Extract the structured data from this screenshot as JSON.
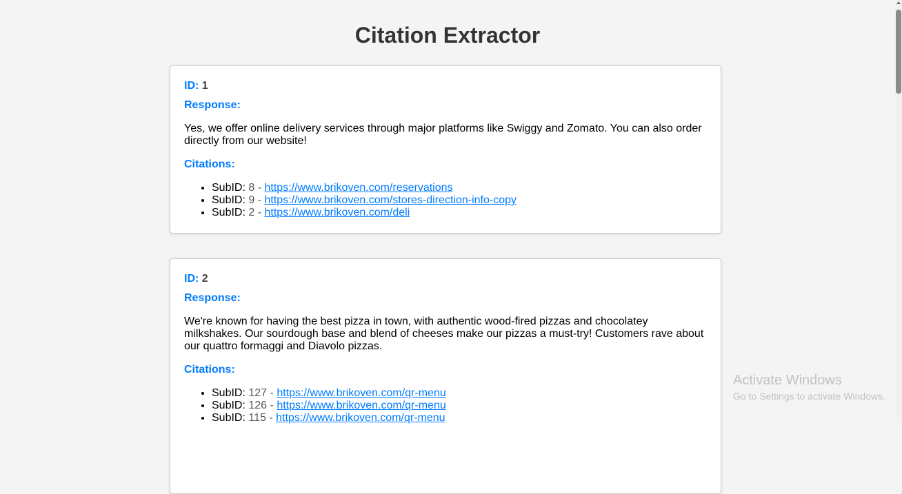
{
  "title": "Citation Extractor",
  "labels": {
    "id": "ID:",
    "response": "Response:",
    "citations": "Citations:",
    "subid": "SubID:",
    "sep": "-"
  },
  "entries": [
    {
      "id": "1",
      "response": "Yes, we offer online delivery services through major platforms like Swiggy and Zomato. You can also order directly from our website!",
      "citations": [
        {
          "subid": "8",
          "url": "https://www.brikoven.com/reservations"
        },
        {
          "subid": "9",
          "url": "https://www.brikoven.com/stores-direction-info-copy"
        },
        {
          "subid": "2",
          "url": "https://www.brikoven.com/deli"
        }
      ]
    },
    {
      "id": "2",
      "response": "We're known for having the best pizza in town, with authentic wood-fired pizzas and chocolatey milkshakes. Our sourdough base and blend of cheeses make our pizzas a must-try! Customers rave about our quattro formaggi and Diavolo pizzas.",
      "citations": [
        {
          "subid": "127",
          "url": "https://www.brikoven.com/qr-menu"
        },
        {
          "subid": "126",
          "url": "https://www.brikoven.com/qr-menu"
        },
        {
          "subid": "115",
          "url": "https://www.brikoven.com/qr-menu"
        }
      ]
    }
  ],
  "watermark": {
    "line1": "Activate Windows",
    "line2": "Go to Settings to activate Windows."
  }
}
